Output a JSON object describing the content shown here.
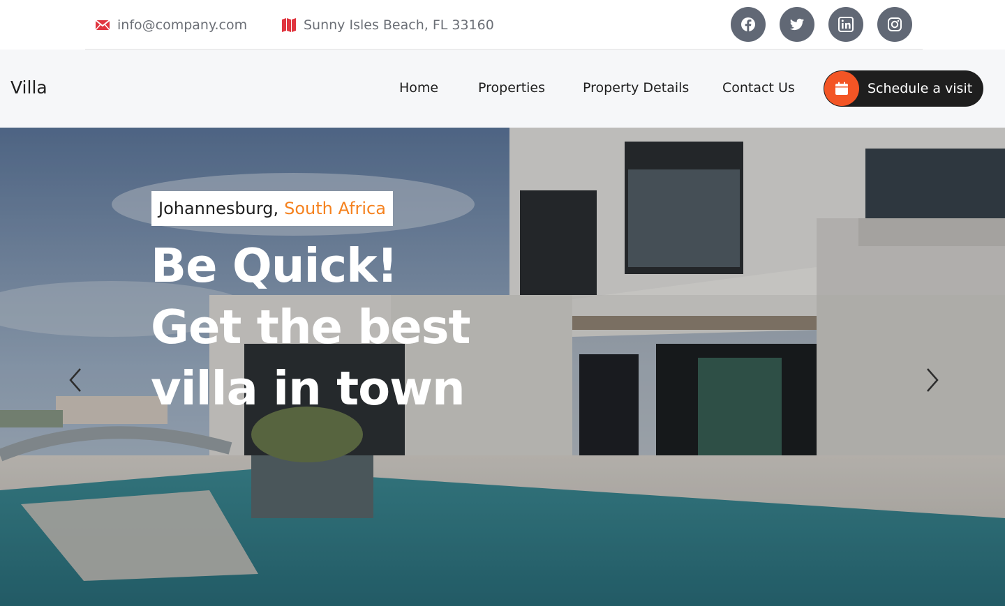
{
  "topbar": {
    "email": "info@company.com",
    "address": "Sunny Isles Beach, FL 33160",
    "email_icon": "envelope-icon",
    "address_icon": "map-icon",
    "social": [
      "facebook-icon",
      "twitter-icon",
      "linkedin-icon",
      "instagram-icon"
    ]
  },
  "nav": {
    "brand": "Villa",
    "links": [
      "Home",
      "Properties",
      "Property Details",
      "Contact Us"
    ],
    "cta": "Schedule a visit",
    "cta_icon": "calendar-icon"
  },
  "hero": {
    "location_city": "Johannesburg,",
    "location_country": "South Africa",
    "headline_lines": [
      "Be Quick!",
      "Get the best",
      "villa in town"
    ],
    "prev_icon": "chevron-left-icon",
    "next_icon": "chevron-right-icon"
  },
  "colors": {
    "accent": "#f35525",
    "country": "#f5821f",
    "social_bg": "#616875",
    "dark": "#1e1e1e",
    "nav_bg": "#f6f7f9"
  }
}
